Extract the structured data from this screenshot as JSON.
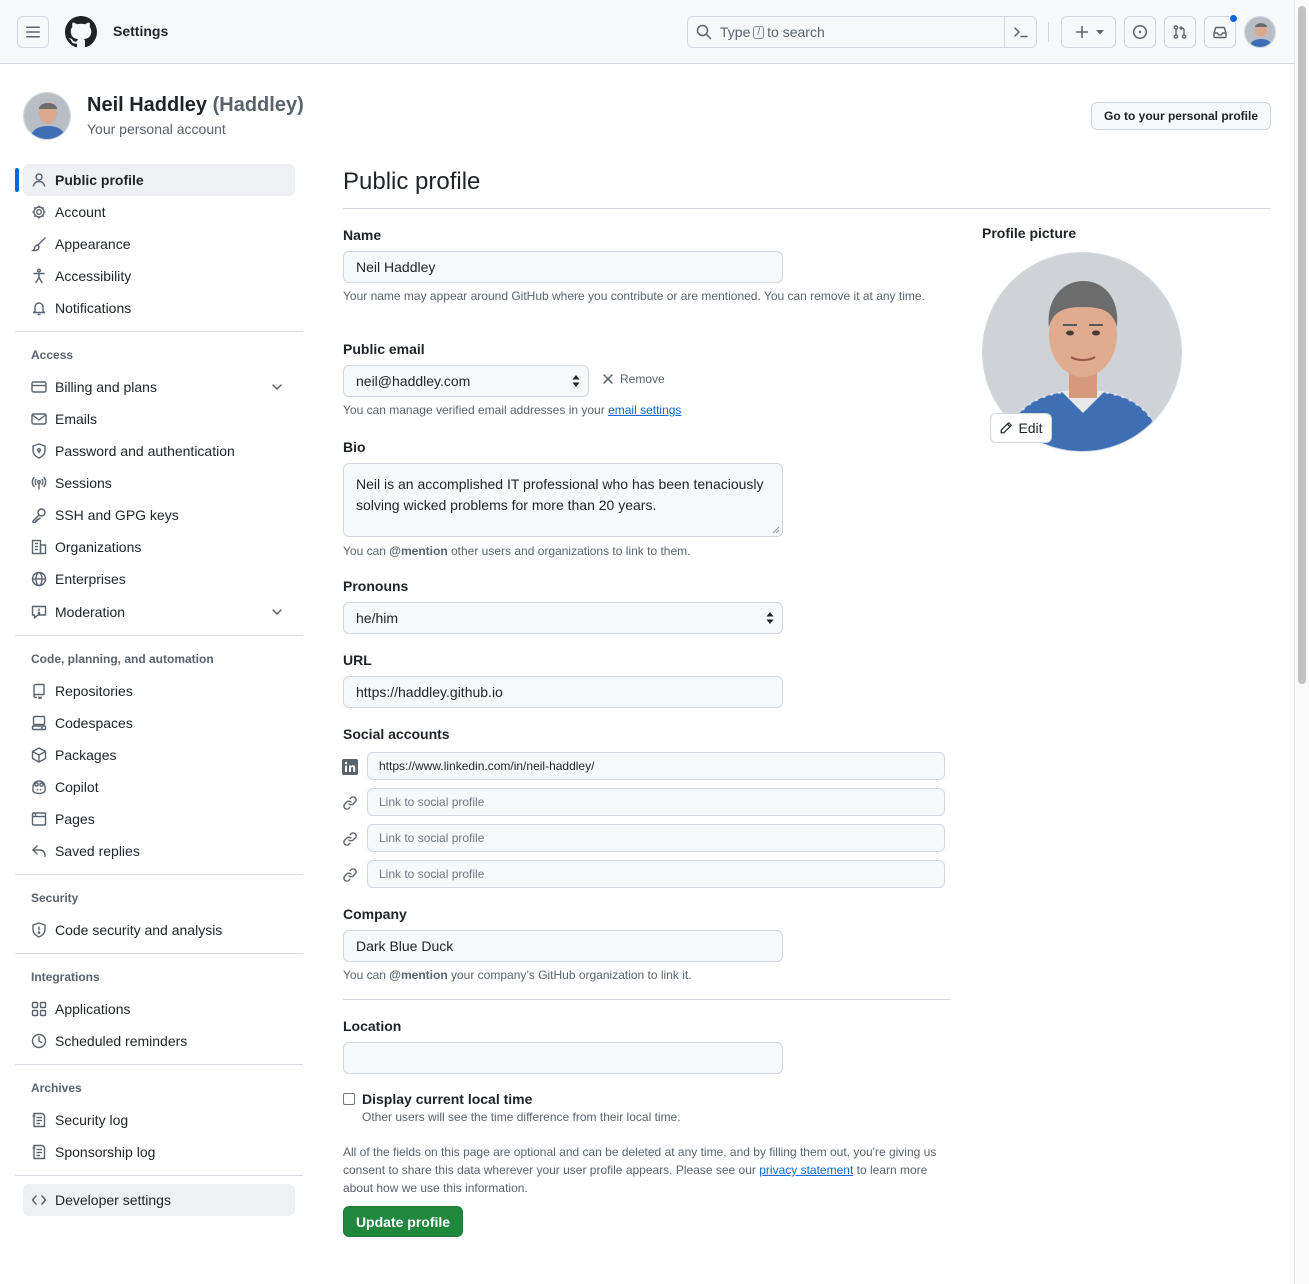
{
  "header": {
    "title": "Settings",
    "search_prefix": "Type",
    "search_key": "/",
    "search_suffix": "to search"
  },
  "account": {
    "name": "Neil Haddley",
    "login": "(Haddley)",
    "subtitle": "Your personal account",
    "go_profile_label": "Go to your personal profile"
  },
  "sidebar": {
    "items": [
      {
        "label": "Public profile",
        "icon": "person-icon"
      },
      {
        "label": "Account",
        "icon": "gear-icon"
      },
      {
        "label": "Appearance",
        "icon": "paintbrush-icon"
      },
      {
        "label": "Accessibility",
        "icon": "accessibility-icon"
      },
      {
        "label": "Notifications",
        "icon": "bell-icon"
      },
      {
        "label": "Billing and plans",
        "icon": "credit-card-icon"
      },
      {
        "label": "Emails",
        "icon": "mail-icon"
      },
      {
        "label": "Password and authentication",
        "icon": "shield-lock-icon"
      },
      {
        "label": "Sessions",
        "icon": "broadcast-icon"
      },
      {
        "label": "SSH and GPG keys",
        "icon": "key-icon"
      },
      {
        "label": "Organizations",
        "icon": "organization-icon"
      },
      {
        "label": "Enterprises",
        "icon": "globe-icon"
      },
      {
        "label": "Moderation",
        "icon": "report-icon"
      },
      {
        "label": "Repositories",
        "icon": "repo-icon"
      },
      {
        "label": "Codespaces",
        "icon": "codespaces-icon"
      },
      {
        "label": "Packages",
        "icon": "package-icon"
      },
      {
        "label": "Copilot",
        "icon": "copilot-icon"
      },
      {
        "label": "Pages",
        "icon": "browser-icon"
      },
      {
        "label": "Saved replies",
        "icon": "reply-icon"
      },
      {
        "label": "Code security and analysis",
        "icon": "shield-icon"
      },
      {
        "label": "Applications",
        "icon": "apps-icon"
      },
      {
        "label": "Scheduled reminders",
        "icon": "clock-icon"
      },
      {
        "label": "Security log",
        "icon": "log-icon"
      },
      {
        "label": "Sponsorship log",
        "icon": "log-icon"
      },
      {
        "label": "Developer settings",
        "icon": "code-icon"
      }
    ],
    "sections": {
      "access": "Access",
      "code": "Code, planning, and automation",
      "security": "Security",
      "integrations": "Integrations",
      "archives": "Archives"
    }
  },
  "main": {
    "title": "Public profile",
    "name": {
      "label": "Name",
      "value": "Neil Haddley",
      "note": "Your name may appear around GitHub where you contribute or are mentioned. You can remove it at any time."
    },
    "email": {
      "label": "Public email",
      "value": "neil@haddley.com",
      "remove_label": "Remove",
      "note_prefix": "You can manage verified email addresses in your",
      "note_link": "email settings"
    },
    "bio": {
      "label": "Bio",
      "value": "Neil is an accomplished IT professional who has been tenaciously solving wicked problems for more than 20 years.",
      "note_prefix": "You can",
      "note_mention": "@mention",
      "note_suffix": "other users and organizations to link to them."
    },
    "pronouns": {
      "label": "Pronouns",
      "value": "he/him"
    },
    "url": {
      "label": "URL",
      "value": "https://haddley.github.io"
    },
    "social": {
      "label": "Social accounts",
      "accounts": [
        {
          "value": "https://www.linkedin.com/in/neil-haddley/",
          "icon": "linkedin-icon"
        },
        {
          "placeholder": "Link to social profile",
          "icon": "link-icon"
        },
        {
          "placeholder": "Link to social profile",
          "icon": "link-icon"
        },
        {
          "placeholder": "Link to social profile",
          "icon": "link-icon"
        }
      ]
    },
    "company": {
      "label": "Company",
      "value": "Dark Blue Duck",
      "note_prefix": "You can",
      "note_mention": "@mention",
      "note_suffix": "your company’s GitHub organization to link it."
    },
    "location": {
      "label": "Location",
      "value": ""
    },
    "local_time": {
      "label": "Display current local time",
      "note": "Other users will see the time difference from their local time.",
      "checked": false
    },
    "disclaimer": {
      "part1": "All of the fields on this page are optional and can be deleted at any time, and by filling them out, you're giving us consent to share this data wherever your user profile appears. Please see our",
      "link": "privacy statement",
      "part2": "to learn more about how we use this information."
    },
    "update_label": "Update profile"
  },
  "profile_picture": {
    "label": "Profile picture",
    "edit_label": "Edit"
  }
}
